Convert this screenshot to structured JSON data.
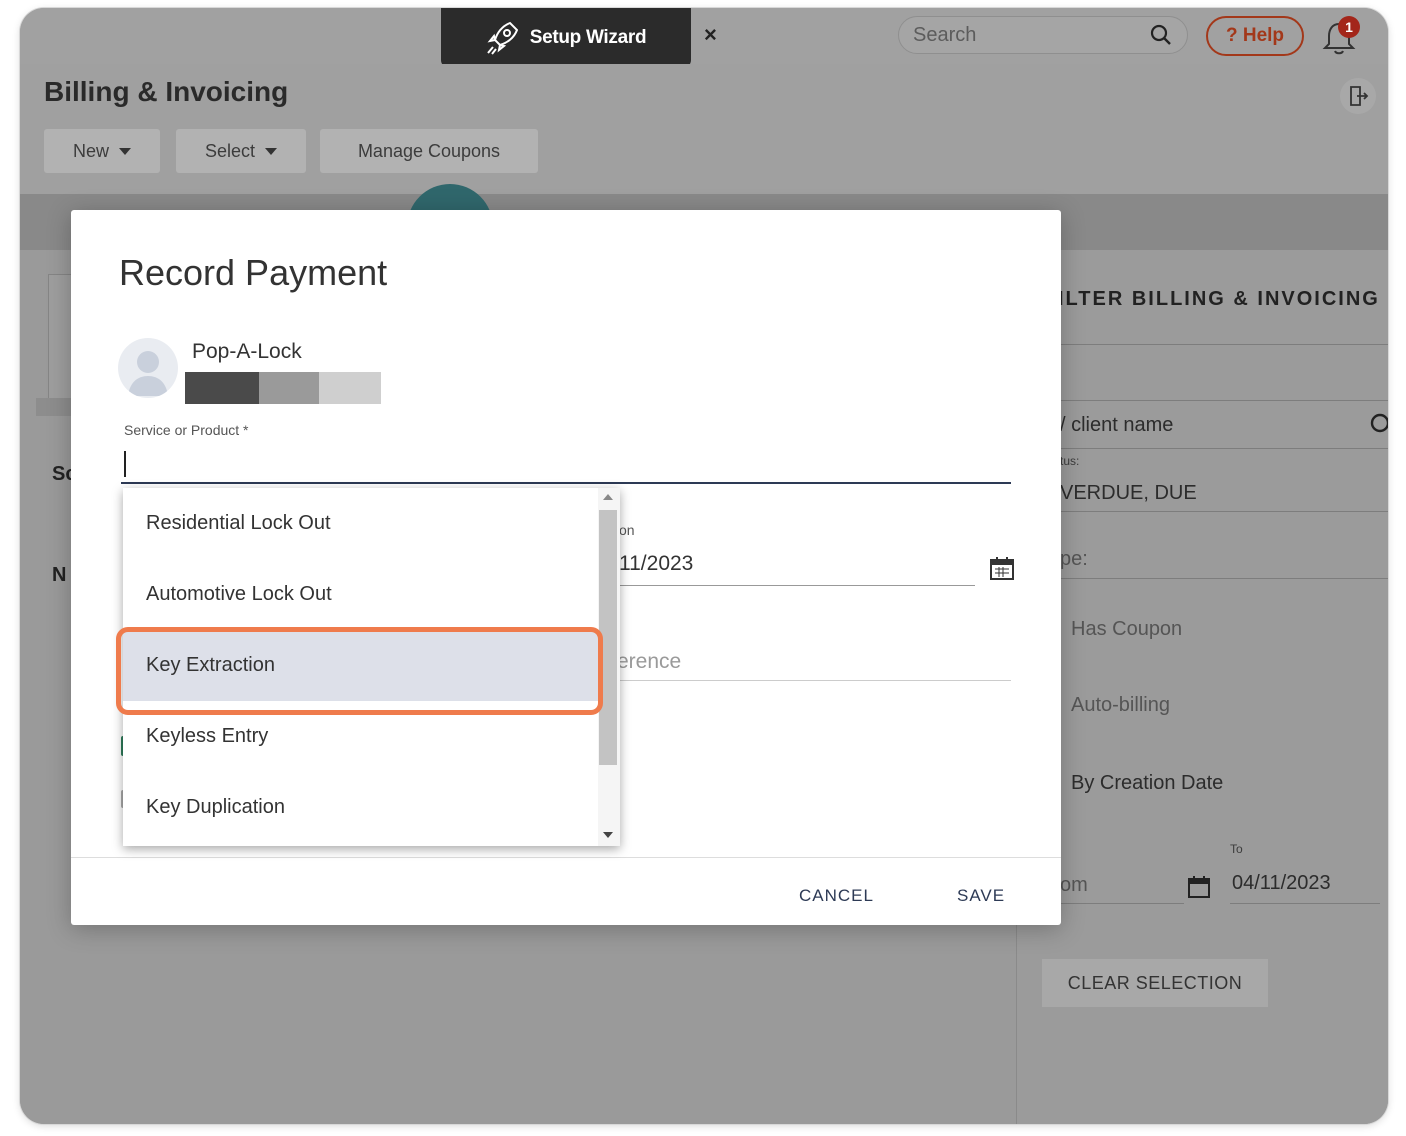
{
  "topbar": {
    "wizard_label": "Setup Wizard",
    "wizard_close": "×",
    "search_placeholder": "Search",
    "help_label": "? Help",
    "notification_count": "1"
  },
  "page": {
    "title": "Billing & Invoicing"
  },
  "toolbar": {
    "new_label": "New",
    "select_label": "Select",
    "coupons_label": "Manage Coupons"
  },
  "left_fragments": {
    "a": "Sc",
    "b": "N"
  },
  "filter_panel": {
    "title": "ILTER BILLING & INVOICING",
    "client_name_placeholder": "/ client name",
    "status_label": "tus:",
    "status_value": "VERDUE, DUE",
    "type_label": "pe:",
    "has_coupon": "Has Coupon",
    "auto_billing": "Auto-billing",
    "by_creation_date": "By Creation Date",
    "from_placeholder": "om",
    "to_label": "To",
    "to_value": "04/11/2023",
    "clear_selection": "CLEAR SELECTION"
  },
  "modal": {
    "title": "Record Payment",
    "client_name": "Pop-A-Lock",
    "service_label": "Service or Product *",
    "date_label": "on",
    "date_value": "11/2023",
    "reference_placeholder": "erence",
    "cancel_label": "CANCEL",
    "save_label": "SAVE"
  },
  "dropdown": {
    "items": [
      "Residential Lock Out",
      "Automotive Lock Out",
      "Key Extraction",
      "Keyless Entry",
      "Key Duplication"
    ],
    "highlighted_index": 2
  },
  "colors": {
    "highlight": "#ef7b4c",
    "help_accent": "#a3381a",
    "active_item_bg": "#dde0e9",
    "primary_text": "#2d3a55"
  }
}
